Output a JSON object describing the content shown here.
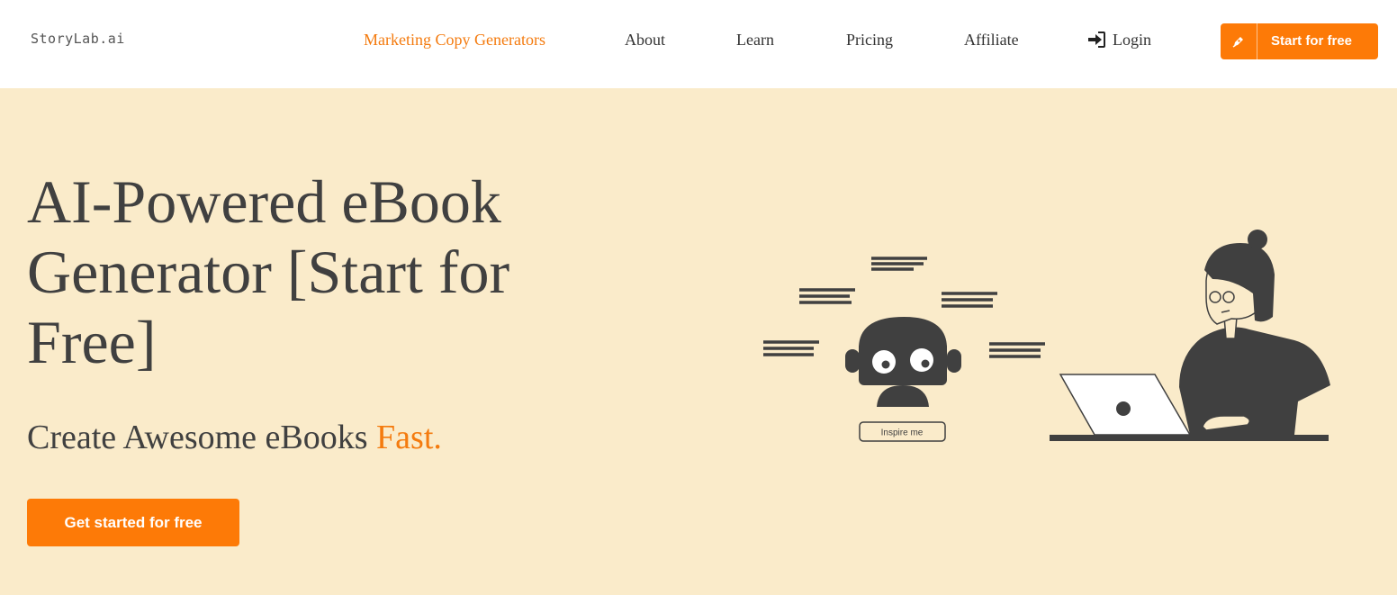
{
  "header": {
    "logo": "StoryLab.ai",
    "nav": [
      {
        "label": "Marketing Copy Generators",
        "active": true
      },
      {
        "label": "About"
      },
      {
        "label": "Learn"
      },
      {
        "label": "Pricing"
      },
      {
        "label": "Affiliate"
      },
      {
        "label": "Login",
        "icon": "sign-in-icon"
      }
    ],
    "cta": {
      "label": "Start for free",
      "icon": "pen-icon"
    }
  },
  "hero": {
    "title": "AI-Powered eBook Generator [Start for Free]",
    "subtitle": "Create Awesome eBooks",
    "subtitle_accent": "Fast.",
    "cta": "Get started for free",
    "illustration": {
      "robot_button": "Inspire me",
      "icons": [
        "robot-icon",
        "person-at-laptop-icon"
      ]
    }
  },
  "colors": {
    "accent": "#f47b0f",
    "button": "#fd7a07",
    "hero_bg": "#faebca",
    "text": "#404040"
  }
}
